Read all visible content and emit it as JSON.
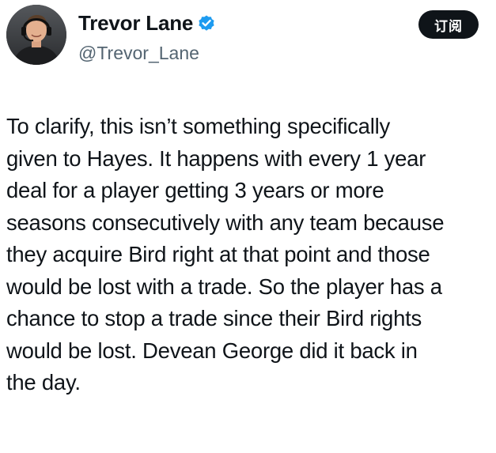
{
  "author": {
    "display_name": "Trevor Lane",
    "handle": "@Trevor_Lane",
    "verified": true,
    "avatar_icon": "profile-photo"
  },
  "actions": {
    "subscribe_label": "订阅"
  },
  "tweet": {
    "lines": [
      "To clarify, this isn’t something specifically",
      "given to Hayes. It happens with every 1 year",
      "deal for a player getting 3 years or more",
      "seasons consecutively with any team because",
      "they acquire Bird right at that point and those",
      "would be lost with a trade. So the player has a",
      "chance to stop a trade since their Bird rights",
      "would be lost. Devean George did it back in",
      "the day."
    ]
  },
  "colors": {
    "text": "#0f1419",
    "secondary_text": "#536471",
    "verified_badge": "#1d9bf0",
    "button_bg": "#0f1419",
    "button_text": "#ffffff"
  }
}
